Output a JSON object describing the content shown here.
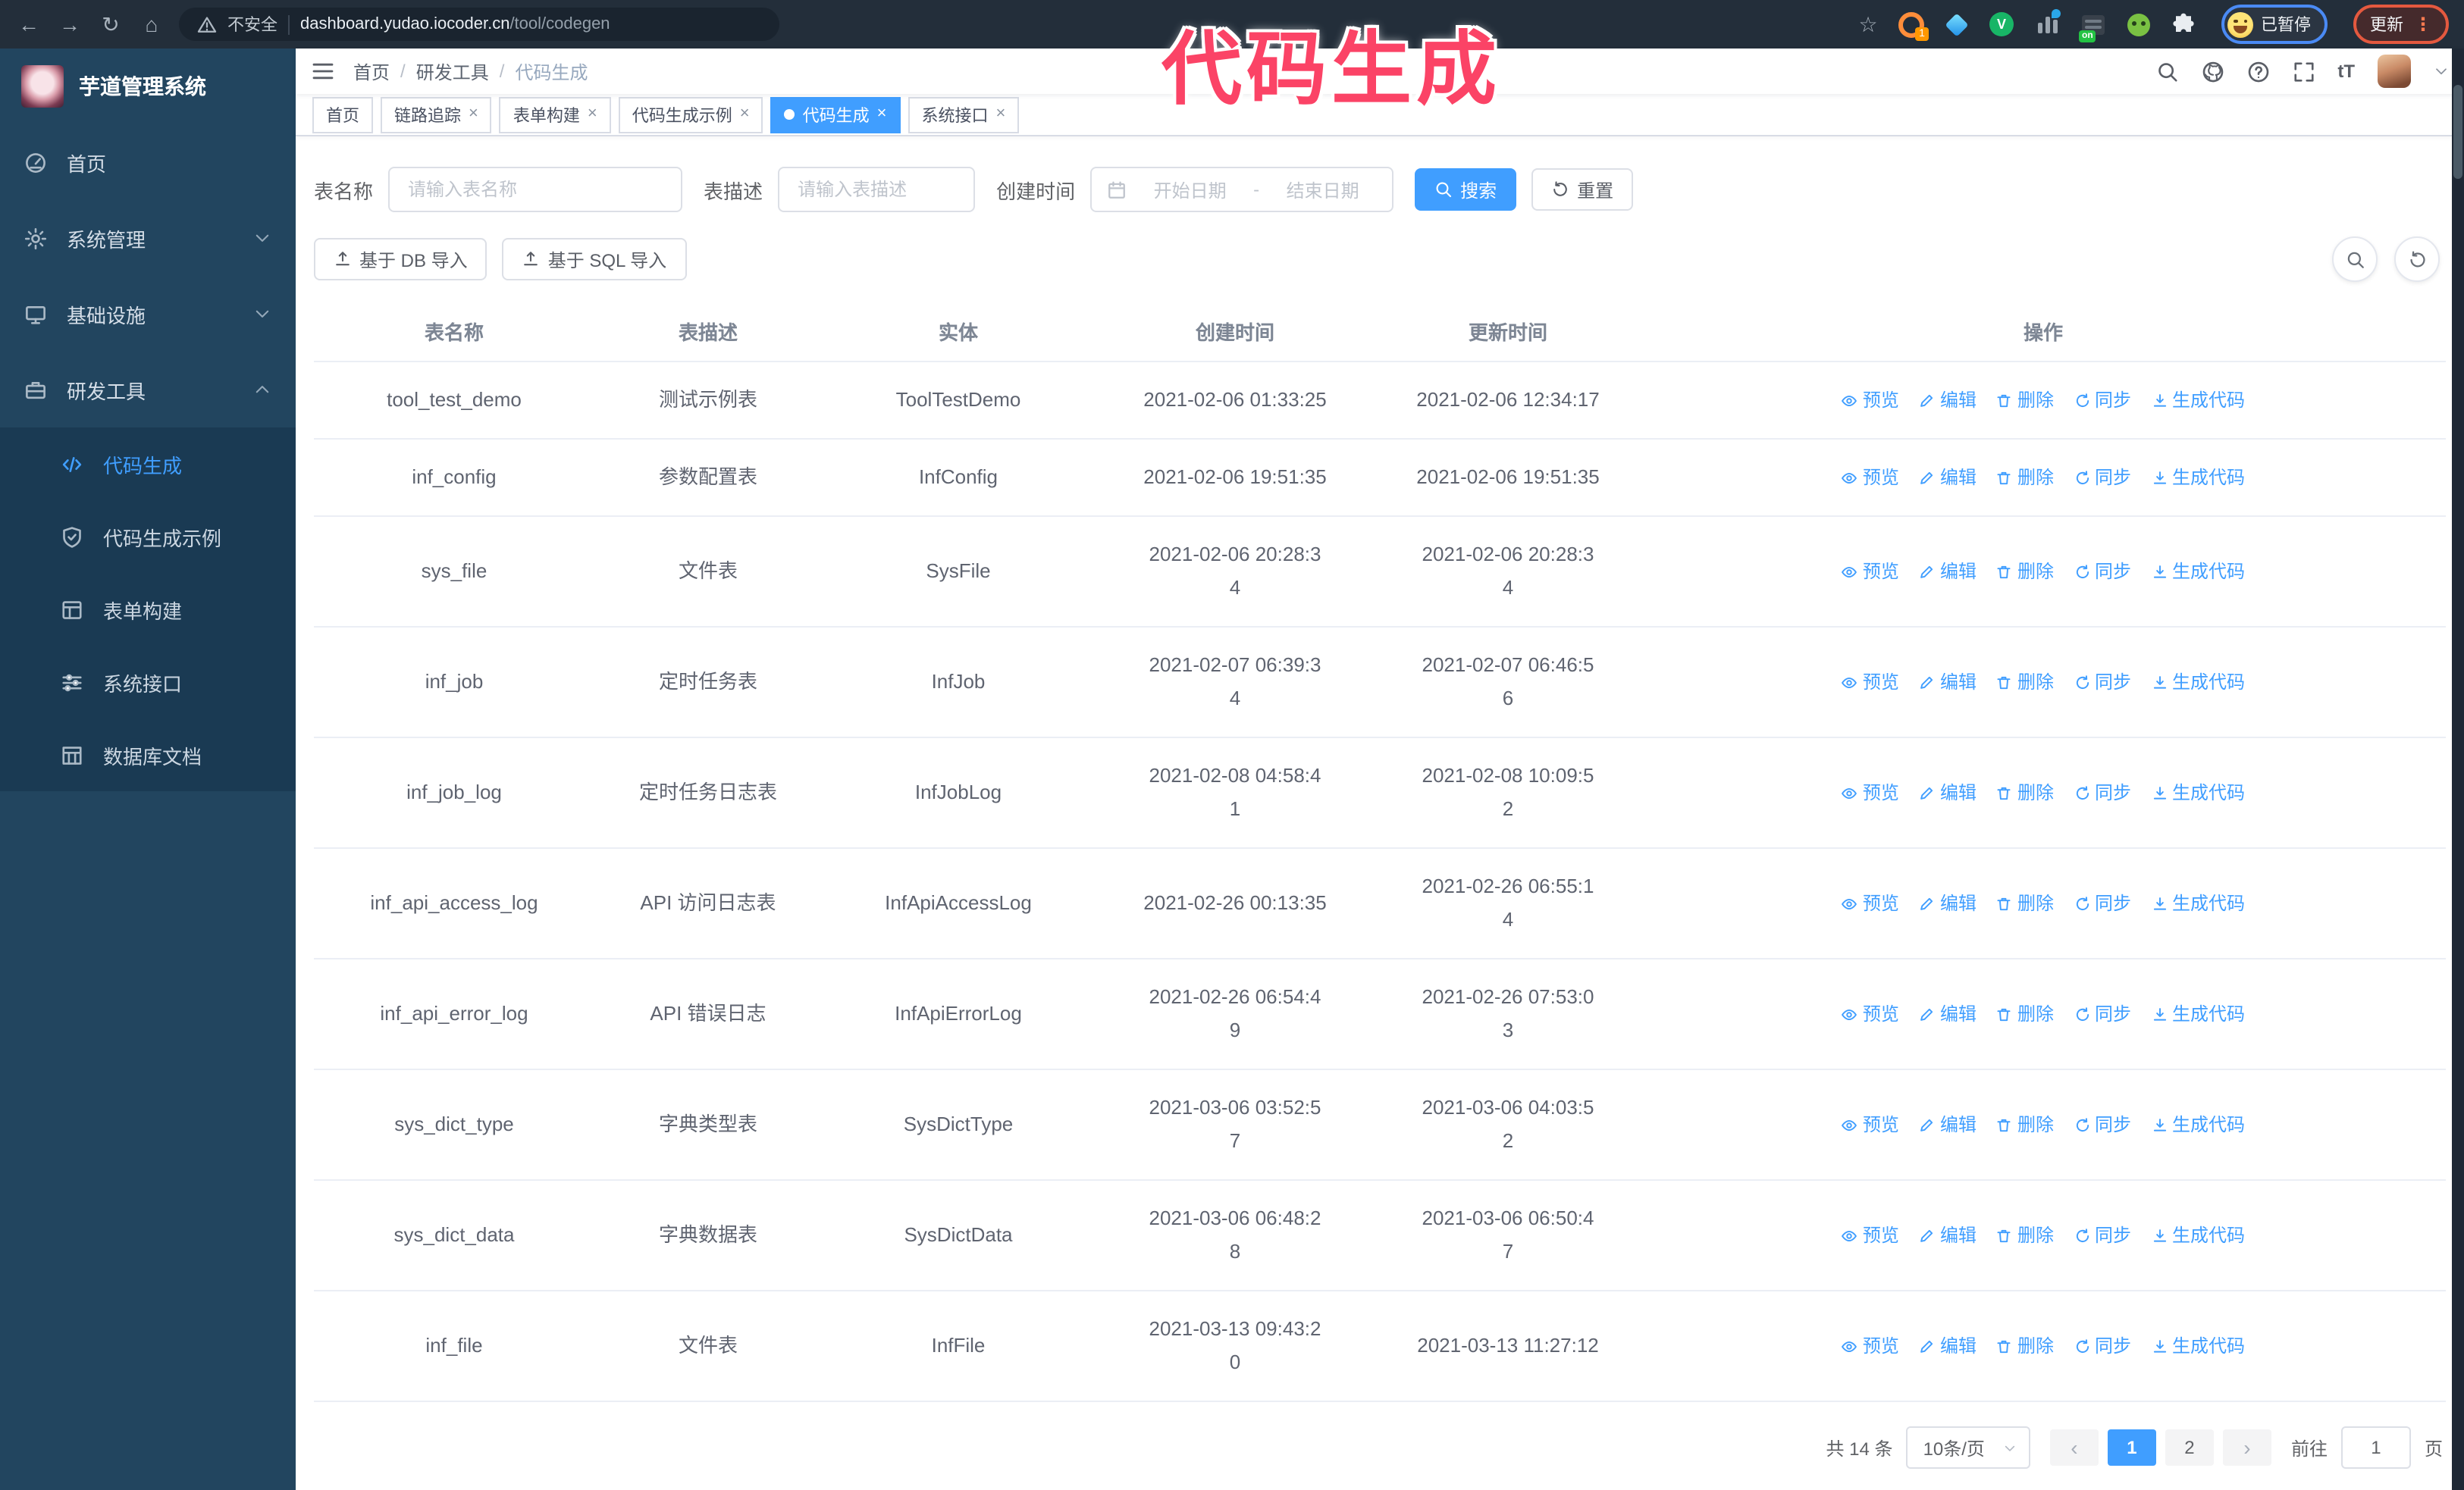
{
  "colors": {
    "primary": "#409EFF",
    "annotation_pink": "#FB4366",
    "sidebar_bg": "#22455F",
    "submenu_bg": "#1A3A53",
    "chrome_bg": "#232E3A"
  },
  "annotation": {
    "title": "代码生成"
  },
  "browser": {
    "security_label": "不安全",
    "url_host": "dashboard.yudao.iocoder.cn",
    "url_path": "/tool/codegen",
    "extension_badge": "1",
    "extension_on_badge": "on",
    "profile_status": "已暂停",
    "update_button": "更新",
    "menu_dots": "⋮",
    "back_icon": "←",
    "forward_icon": "→",
    "reload_icon": "↻",
    "home_icon": "⌂",
    "star_icon": "☆"
  },
  "header": {
    "breadcrumb": [
      "首页",
      "研发工具",
      "代码生成"
    ],
    "font_size_icon_label": "tT"
  },
  "tags": [
    {
      "label": "首页",
      "closable": false,
      "active": false
    },
    {
      "label": "链路追踪",
      "closable": true,
      "active": false
    },
    {
      "label": "表单构建",
      "closable": true,
      "active": false
    },
    {
      "label": "代码生成示例",
      "closable": true,
      "active": false
    },
    {
      "label": "代码生成",
      "closable": true,
      "active": true
    },
    {
      "label": "系统接口",
      "closable": true,
      "active": false
    }
  ],
  "sidebar": {
    "app_title": "芋道管理系统",
    "menu": [
      {
        "label": "首页",
        "icon": "dashboard-icon",
        "type": "item"
      },
      {
        "label": "系统管理",
        "icon": "gear-icon",
        "type": "group",
        "expanded": false
      },
      {
        "label": "基础设施",
        "icon": "monitor-icon",
        "type": "group",
        "expanded": false
      },
      {
        "label": "研发工具",
        "icon": "toolbox-icon",
        "type": "group",
        "expanded": true
      }
    ],
    "submenu": [
      {
        "label": "代码生成",
        "icon": "code-icon",
        "active": true
      },
      {
        "label": "代码生成示例",
        "icon": "shield-check-icon",
        "active": false
      },
      {
        "label": "表单构建",
        "icon": "form-icon",
        "active": false
      },
      {
        "label": "系统接口",
        "icon": "sliders-icon",
        "active": false
      },
      {
        "label": "数据库文档",
        "icon": "database-doc-icon",
        "active": false
      }
    ]
  },
  "filters": {
    "table_name_label": "表名称",
    "table_name_placeholder": "请输入表名称",
    "table_desc_label": "表描述",
    "table_desc_placeholder": "请输入表描述",
    "create_time_label": "创建时间",
    "date_start_placeholder": "开始日期",
    "date_separator": "-",
    "date_end_placeholder": "结束日期",
    "search_button": "搜索",
    "reset_button": "重置"
  },
  "toolbar": {
    "import_db_button": "基于 DB 导入",
    "import_sql_button": "基于 SQL 导入"
  },
  "table": {
    "columns": [
      "表名称",
      "表描述",
      "实体",
      "创建时间",
      "更新时间",
      "操作"
    ],
    "row_actions": [
      {
        "label": "预览",
        "icon": "eye-icon"
      },
      {
        "label": "编辑",
        "icon": "edit-icon"
      },
      {
        "label": "删除",
        "icon": "delete-icon"
      },
      {
        "label": "同步",
        "icon": "sync-icon"
      },
      {
        "label": "生成代码",
        "icon": "download-icon"
      }
    ],
    "rows": [
      {
        "name": "tool_test_demo",
        "desc": "测试示例表",
        "entity": "ToolTestDemo",
        "create_time": "2021-02-06 01:33:25",
        "update_time": "2021-02-06 12:34:17"
      },
      {
        "name": "inf_config",
        "desc": "参数配置表",
        "entity": "InfConfig",
        "create_time": "2021-02-06 19:51:35",
        "update_time": "2021-02-06 19:51:35"
      },
      {
        "name": "sys_file",
        "desc": "文件表",
        "entity": "SysFile",
        "create_time": "2021-02-06 20:28:3\n4",
        "update_time": "2021-02-06 20:28:3\n4"
      },
      {
        "name": "inf_job",
        "desc": "定时任务表",
        "entity": "InfJob",
        "create_time": "2021-02-07 06:39:3\n4",
        "update_time": "2021-02-07 06:46:5\n6"
      },
      {
        "name": "inf_job_log",
        "desc": "定时任务日志表",
        "entity": "InfJobLog",
        "create_time": "2021-02-08 04:58:4\n1",
        "update_time": "2021-02-08 10:09:5\n2"
      },
      {
        "name": "inf_api_access_log",
        "desc": "API 访问日志表",
        "entity": "InfApiAccessLog",
        "create_time": "2021-02-26 00:13:35",
        "update_time": "2021-02-26 06:55:1\n4"
      },
      {
        "name": "inf_api_error_log",
        "desc": "API 错误日志",
        "entity": "InfApiErrorLog",
        "create_time": "2021-02-26 06:54:4\n9",
        "update_time": "2021-02-26 07:53:0\n3"
      },
      {
        "name": "sys_dict_type",
        "desc": "字典类型表",
        "entity": "SysDictType",
        "create_time": "2021-03-06 03:52:5\n7",
        "update_time": "2021-03-06 04:03:5\n2"
      },
      {
        "name": "sys_dict_data",
        "desc": "字典数据表",
        "entity": "SysDictData",
        "create_time": "2021-03-06 06:48:2\n8",
        "update_time": "2021-03-06 06:50:4\n7"
      },
      {
        "name": "inf_file",
        "desc": "文件表",
        "entity": "InfFile",
        "create_time": "2021-03-13 09:43:2\n0",
        "update_time": "2021-03-13 11:27:12"
      }
    ]
  },
  "pagination": {
    "total_label": "共 14 条",
    "page_size": "10条/页",
    "prev_icon": "‹",
    "next_icon": "›",
    "pages": [
      "1",
      "2"
    ],
    "active_page": "1",
    "goto_label": "前往",
    "goto_value": "1",
    "page_unit": "页"
  }
}
